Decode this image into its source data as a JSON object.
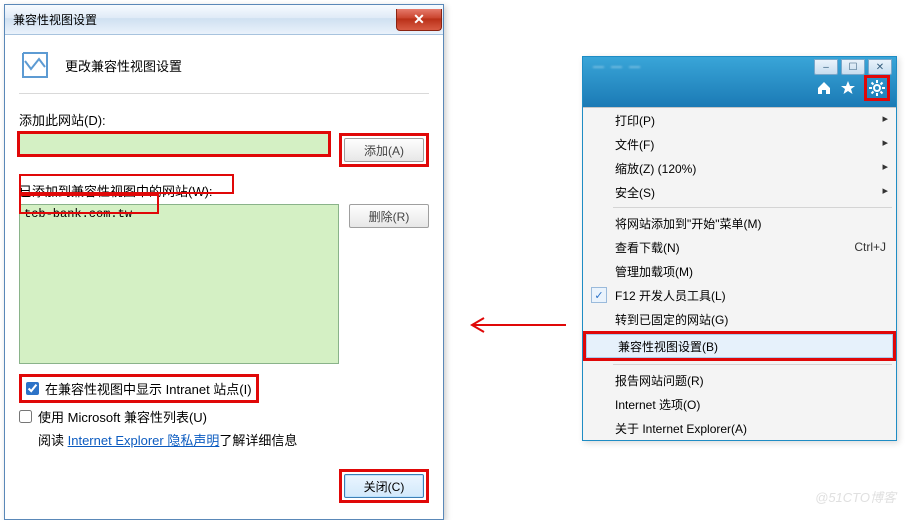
{
  "dialog": {
    "title": "兼容性视图设置",
    "heading": "更改兼容性视图设置",
    "add_site_label": "添加此网站(D):",
    "add_button": "添加(A)",
    "list_label": "已添加到兼容性视图中的网站(W):",
    "remove_button": "删除(R)",
    "site_input_value": "",
    "listed_sites": [
      "tcb-bank.com.tw"
    ],
    "cb_intranet": "在兼容性视图中显示 Intranet 站点(I)",
    "cb_intranet_checked": true,
    "cb_mslist": "使用 Microsoft 兼容性列表(U)",
    "cb_mslist_checked": false,
    "privacy_prefix": "阅读 ",
    "privacy_link": "Internet Explorer 隐私声明",
    "privacy_suffix": "了解详细信息",
    "close_button": "关闭(C)"
  },
  "browser": {
    "title_blur": "— — —",
    "icons": {
      "home": "home-icon",
      "star": "star-icon",
      "gear": "gear-icon"
    }
  },
  "menu": {
    "items": [
      {
        "label": "打印(P)",
        "sub": true
      },
      {
        "label": "文件(F)",
        "sub": true
      },
      {
        "label": "缩放(Z) (120%)",
        "sub": true
      },
      {
        "label": "安全(S)",
        "sub": true
      },
      {
        "sep": true
      },
      {
        "label": "将网站添加到\"开始\"菜单(M)"
      },
      {
        "label": "查看下载(N)",
        "shortcut": "Ctrl+J"
      },
      {
        "label": "管理加载项(M)"
      },
      {
        "label": "F12 开发人员工具(L)",
        "checked": true
      },
      {
        "label": "转到已固定的网站(G)"
      },
      {
        "label": "兼容性视图设置(B)",
        "selected": true
      },
      {
        "sep": true
      },
      {
        "label": "报告网站问题(R)"
      },
      {
        "label": "Internet 选项(O)"
      },
      {
        "label": "关于 Internet Explorer(A)"
      }
    ]
  },
  "watermark": "@51CTO博客"
}
